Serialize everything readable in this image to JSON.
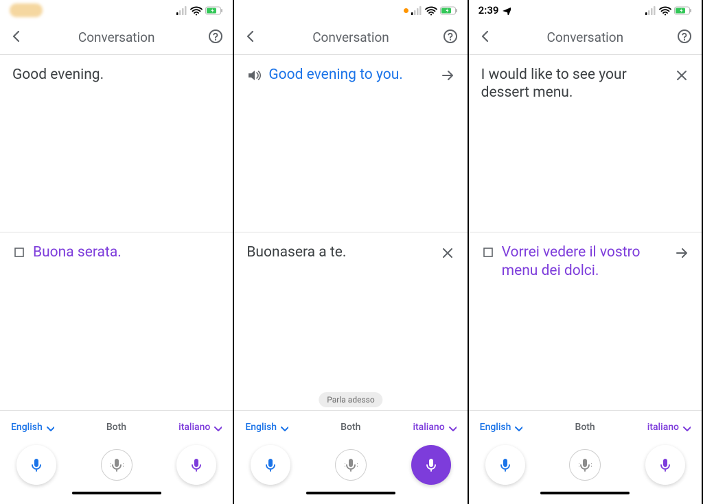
{
  "screens": [
    {
      "status": {
        "time": "",
        "show_time_blur": true,
        "location_arrow": false,
        "orange_dot": false
      },
      "nav": {
        "title": "Conversation"
      },
      "top": {
        "lead_icon": "none",
        "text": "Good evening.",
        "text_color": "plain",
        "trail_icon": "none"
      },
      "bottom_pane": {
        "lead_icon": "expand",
        "text": "Buona serata.",
        "text_color": "purple",
        "trail_icon": "none"
      },
      "hint": "",
      "langs": {
        "left": "English",
        "center": "Both",
        "right": "italiano"
      },
      "mic_active": "none"
    },
    {
      "status": {
        "time": "",
        "show_time_blur": false,
        "location_arrow": false,
        "orange_dot": true
      },
      "nav": {
        "title": "Conversation"
      },
      "top": {
        "lead_icon": "speaker",
        "text": "Good evening to you.",
        "text_color": "blue",
        "trail_icon": "arrow"
      },
      "bottom_pane": {
        "lead_icon": "none",
        "text": "Buonasera a te.",
        "text_color": "plain",
        "trail_icon": "close"
      },
      "hint": "Parla adesso",
      "langs": {
        "left": "English",
        "center": "Both",
        "right": "italiano"
      },
      "mic_active": "right"
    },
    {
      "status": {
        "time": "2:39",
        "show_time_blur": false,
        "location_arrow": true,
        "orange_dot": false
      },
      "nav": {
        "title": "Conversation"
      },
      "top": {
        "lead_icon": "none",
        "text": "I would like to see your dessert menu.",
        "text_color": "plain",
        "trail_icon": "close"
      },
      "bottom_pane": {
        "lead_icon": "expand",
        "text": "Vorrei vedere il vostro menu dei dolci.",
        "text_color": "purple",
        "trail_icon": "arrow"
      },
      "hint": "",
      "langs": {
        "left": "English",
        "center": "Both",
        "right": "italiano"
      },
      "mic_active": "none"
    }
  ]
}
